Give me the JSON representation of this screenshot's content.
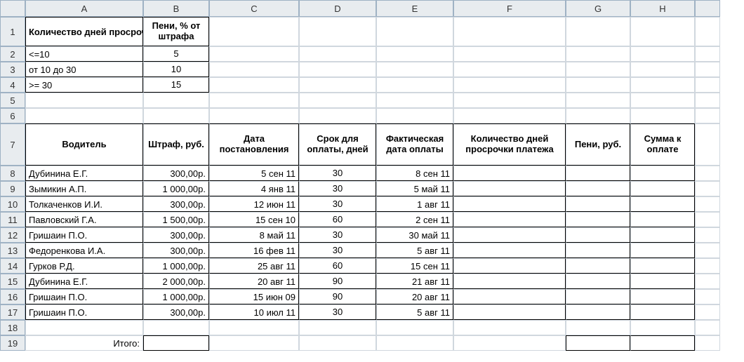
{
  "cols": [
    "A",
    "B",
    "C",
    "D",
    "E",
    "F",
    "G",
    "H"
  ],
  "top": {
    "h1": "Количество дней просрочки платежа",
    "h2": "Пени, % от штрафа",
    "rows": [
      {
        "a": "<=10",
        "b": "5"
      },
      {
        "a": "от 10 до 30",
        "b": "10"
      },
      {
        "a": ">= 30",
        "b": "15"
      }
    ]
  },
  "headers": {
    "a": "Водитель",
    "b": "Штраф, руб.",
    "c": "Дата постановления",
    "d": "Срок для оплаты, дней",
    "e": "Фактическая дата оплаты",
    "f": "Количество дней просрочки платежа",
    "g": "Пени, руб.",
    "h": "Сумма к оплате"
  },
  "rows": [
    {
      "a": "Дубинина Е.Г.",
      "b": "300,00р.",
      "c": "5 сен 11",
      "d": "30",
      "e": "8 сен 11"
    },
    {
      "a": "Зымикин А.П.",
      "b": "1 000,00р.",
      "c": "4 янв 11",
      "d": "30",
      "e": "5 май 11"
    },
    {
      "a": "Толкаченков И.И.",
      "b": "300,00р.",
      "c": "12 июн 11",
      "d": "30",
      "e": "1 авг 11"
    },
    {
      "a": "Павловский Г.А.",
      "b": "1 500,00р.",
      "c": "15 сен 10",
      "d": "60",
      "e": "2 сен 11"
    },
    {
      "a": "Гришаин П.О.",
      "b": "300,00р.",
      "c": "8 май 11",
      "d": "30",
      "e": "30 май 11"
    },
    {
      "a": "Федоренкова И.А.",
      "b": "300,00р.",
      "c": "16 фев 11",
      "d": "30",
      "e": "5 авг 11"
    },
    {
      "a": "Гурков Р.Д.",
      "b": "1 000,00р.",
      "c": "25 авг 11",
      "d": "60",
      "e": "15 сен 11"
    },
    {
      "a": "Дубинина Е.Г.",
      "b": "2 000,00р.",
      "c": "20 авг 11",
      "d": "90",
      "e": "21 авг 11"
    },
    {
      "a": "Гришаин П.О.",
      "b": "1 000,00р.",
      "c": "15 июн 09",
      "d": "90",
      "e": "20 авг 11"
    },
    {
      "a": "Гришаин П.О.",
      "b": "300,00р.",
      "c": "10 июл 11",
      "d": "30",
      "e": "5 авг 11"
    }
  ],
  "footer": {
    "label": "Итого:"
  }
}
